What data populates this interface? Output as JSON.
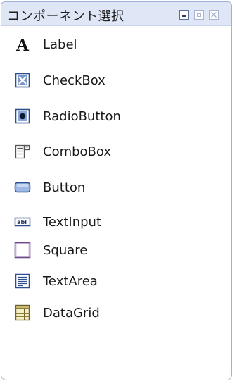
{
  "window": {
    "title": "コンポーネント選択"
  },
  "components": [
    {
      "label": "Label",
      "icon": "label-icon"
    },
    {
      "label": "CheckBox",
      "icon": "checkbox-icon"
    },
    {
      "label": "RadioButton",
      "icon": "radiobutton-icon"
    },
    {
      "label": "ComboBox",
      "icon": "combobox-icon"
    },
    {
      "label": "Button",
      "icon": "button-icon"
    },
    {
      "label": "TextInput",
      "icon": "textinput-icon"
    },
    {
      "label": "Square",
      "icon": "square-icon"
    },
    {
      "label": "TextArea",
      "icon": "textarea-icon"
    },
    {
      "label": "DataGrid",
      "icon": "datagrid-icon"
    }
  ],
  "colors": {
    "titlebar": "#dfe6f6",
    "border": "#9fb0d9",
    "icon_blue": "#3a5fa8"
  }
}
